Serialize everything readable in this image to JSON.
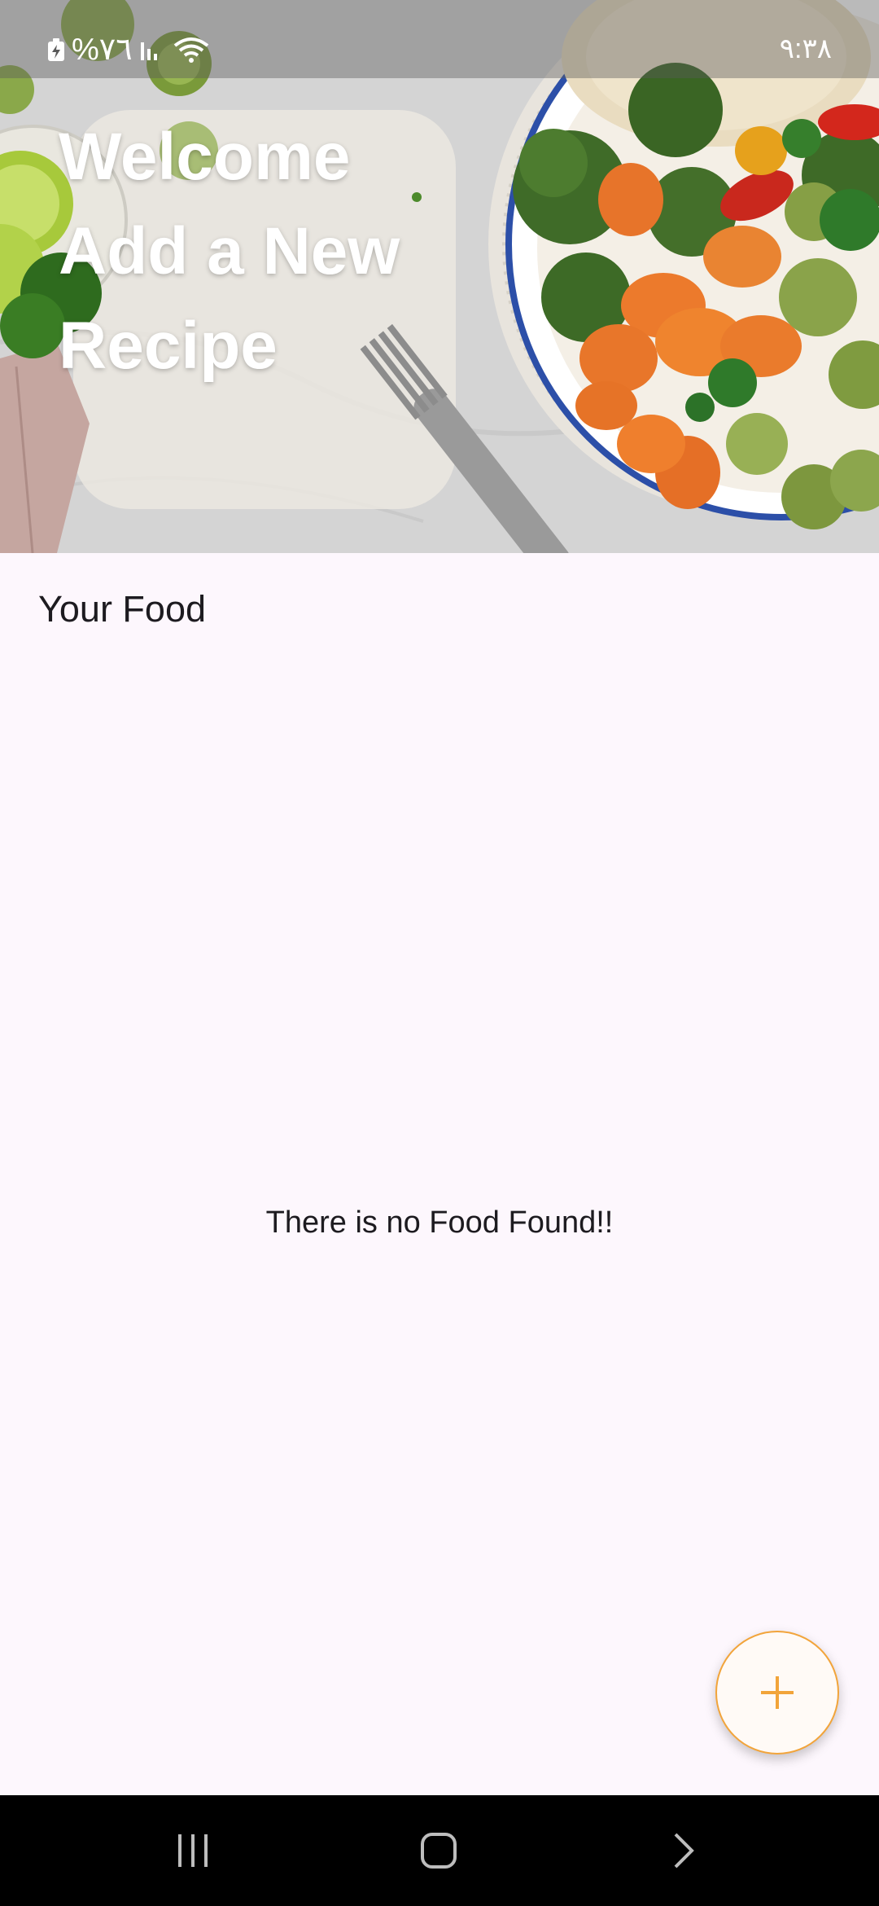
{
  "status_bar": {
    "battery_text": "%٧٦",
    "time": "٩:٣٨"
  },
  "hero": {
    "title_lines": [
      "Welcome",
      "Add a New",
      "Recipe"
    ]
  },
  "main": {
    "section_title": "Your Food",
    "empty_message": "There is no Food Found!!"
  },
  "fab": {
    "icon": "plus-icon",
    "accent": "#f2a43a"
  },
  "nav": {
    "recents_icon": "recents-icon",
    "home_icon": "home-icon",
    "back_icon": "back-icon"
  },
  "colors": {
    "background": "#fdf7fd",
    "text": "#1d1b20",
    "nav_background": "#000000"
  }
}
